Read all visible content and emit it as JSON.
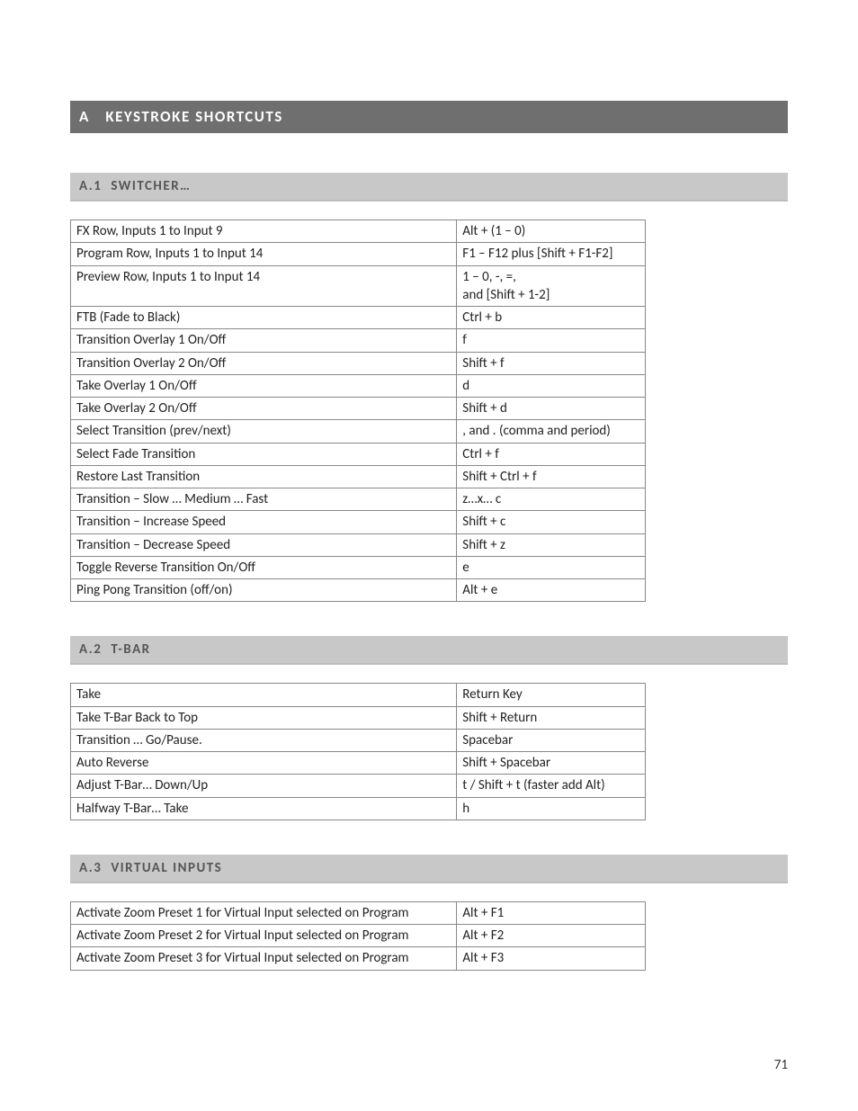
{
  "appendix": {
    "letter": "A",
    "title": "KEYSTROKE SHORTCUTS"
  },
  "sections": [
    {
      "num": "A.1",
      "title": "SWITCHER…"
    },
    {
      "num": "A.2",
      "title": "T-BAR"
    },
    {
      "num": "A.3",
      "title": "VIRTUAL INPUTS"
    }
  ],
  "tables": {
    "switcher": [
      {
        "desc": "FX Row, Inputs 1 to Input 9",
        "key": "Alt + (1 –  0)"
      },
      {
        "desc": "Program Row, Inputs 1 to Input 14",
        "key": "F1 – F12 plus [Shift + F1-F2]"
      },
      {
        "desc": "Preview Row, Inputs 1 to Input 14",
        "key": "1 – 0,  -,  =,\nand [Shift + 1-2]"
      },
      {
        "desc": "FTB (Fade to Black)",
        "key": "Ctrl + b"
      },
      {
        "desc": "Transition Overlay 1 On/Off",
        "key": "f"
      },
      {
        "desc": "Transition Overlay 2 On/Off",
        "key": "Shift  + f"
      },
      {
        "desc": "Take Overlay 1 On/Off",
        "key": "d"
      },
      {
        "desc": "Take Overlay 2 On/Off",
        "key": "Shift  + d"
      },
      {
        "desc": "Select Transition (prev/next)",
        "key": ", and . (comma and period)",
        "justify": true
      },
      {
        "desc": "Select Fade Transition",
        "key": "Ctrl + f"
      },
      {
        "desc": "Restore Last Transition",
        "key": "Shift + Ctrl + f"
      },
      {
        "desc": "Transition – Slow … Medium … Fast",
        "key": "z…x… c"
      },
      {
        "desc": "Transition – Increase Speed",
        "key": "Shift + c"
      },
      {
        "desc": "Transition – Decrease Speed",
        "key": "Shift + z"
      },
      {
        "desc": "Toggle Reverse Transition On/Off",
        "key": "e"
      },
      {
        "desc": "Ping Pong Transition (off/on)",
        "key": "Alt + e"
      }
    ],
    "tbar": [
      {
        "desc": "Take",
        "key": "Return Key"
      },
      {
        "desc": "Take T-Bar Back to Top",
        "key": "Shift + Return"
      },
      {
        "desc": "Transition … Go/Pause.",
        "key": "Spacebar"
      },
      {
        "desc": "Auto Reverse",
        "key": "Shift + Spacebar"
      },
      {
        "desc": "Adjust T-Bar… Down/Up",
        "key": "t / Shift + t (faster add Alt)"
      },
      {
        "desc": "Halfway T-Bar… Take",
        "key": "h"
      }
    ],
    "vinputs": [
      {
        "desc": "Activate Zoom Preset 1 for Virtual Input selected on Program",
        "key": "Alt + F1",
        "justify": true
      },
      {
        "desc": "Activate Zoom Preset 2 for Virtual Input selected on Program",
        "key": "Alt + F2",
        "justify": true
      },
      {
        "desc": "Activate Zoom Preset 3 for Virtual Input selected on Program",
        "key": "Alt + F3",
        "justify": true
      }
    ]
  },
  "page_number": "71"
}
